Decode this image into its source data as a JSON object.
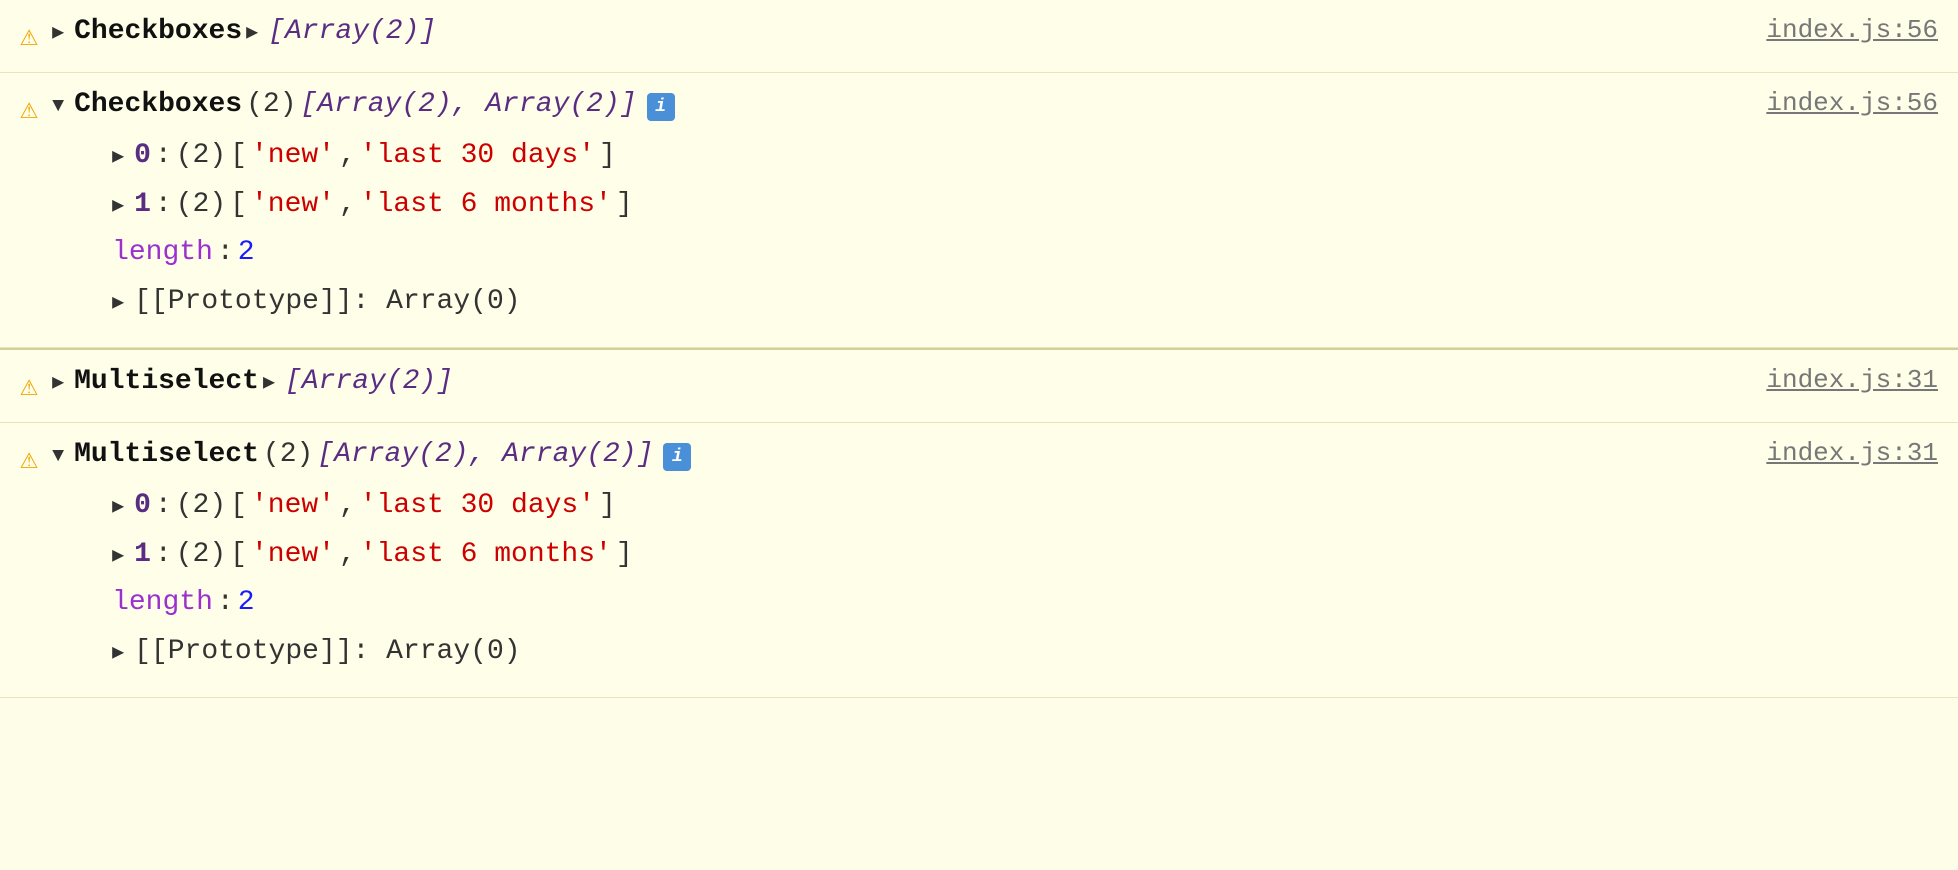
{
  "console": {
    "entries": [
      {
        "id": "entry-1",
        "type": "collapsed",
        "warn": true,
        "component": "Checkboxes",
        "summary": "[Array(2)]",
        "fileLink": "index.js:56"
      },
      {
        "id": "entry-2",
        "type": "expanded",
        "warn": true,
        "component": "Checkboxes",
        "count": "(2)",
        "arrayItems": "[Array(2), Array(2)]",
        "hasInfo": true,
        "children": [
          {
            "index": "0",
            "count": "(2)",
            "values": [
              "'new'",
              "'last 30 days'"
            ]
          },
          {
            "index": "1",
            "count": "(2)",
            "values": [
              "'new'",
              "'last 6 months'"
            ]
          }
        ],
        "length": "2",
        "prototype": "[[Prototype]]: Array(0)",
        "fileLink": "index.js:56"
      },
      {
        "id": "entry-3",
        "type": "collapsed",
        "warn": true,
        "component": "Multiselect",
        "summary": "[Array(2)]",
        "fileLink": "index.js:31"
      },
      {
        "id": "entry-4",
        "type": "expanded",
        "warn": true,
        "component": "Multiselect",
        "count": "(2)",
        "arrayItems": "[Array(2), Array(2)]",
        "hasInfo": true,
        "children": [
          {
            "index": "0",
            "count": "(2)",
            "values": [
              "'new'",
              "'last 30 days'"
            ]
          },
          {
            "index": "1",
            "count": "(2)",
            "values": [
              "'new'",
              "'last 6 months'"
            ]
          }
        ],
        "length": "2",
        "prototype": "[[Prototype]]: Array(0)",
        "fileLink": "index.js:31"
      }
    ],
    "labels": {
      "expandArrowRight": "▶",
      "expandArrowDown": "▼",
      "warnIcon": "⚠",
      "infoIcon": "i",
      "lengthLabel": "length",
      "colonSep": ":",
      "commaSep": ","
    }
  }
}
